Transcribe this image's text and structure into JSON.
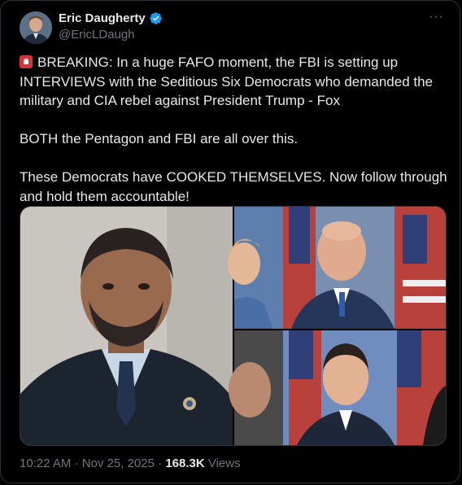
{
  "author": {
    "name": "Eric Daugherty",
    "handle": "@EricLDaugh",
    "verified": true,
    "verified_color": "#1d9bf0"
  },
  "menu_icon": "more-horizontal-icon",
  "tweet": {
    "lead_icon": "rotating-light-emoji",
    "paragraph1": "BREAKING: In a huge FAFO moment, the FBI is setting up INTERVIEWS with the Seditious Six Democrats who demanded the military and CIA rebel against President Trump - Fox",
    "paragraph2": "BOTH the Pentagon and FBI are all over this.",
    "paragraph3": "These Democrats have COOKED THEMSELVES. Now follow through and hold them accountable!"
  },
  "media": {
    "left_image": "photo of man in suit with lapel pin",
    "right_image": "collage of official portraits with American flags"
  },
  "meta": {
    "time": "10:22 AM",
    "separator1": " · ",
    "date": "Nov 25, 2025",
    "separator2": " · ",
    "views_count": "168.3K",
    "views_label": " Views"
  },
  "colors": {
    "background": "#000000",
    "text_primary": "#e7e9ea",
    "text_secondary": "#71767b",
    "border": "#2f3336"
  }
}
